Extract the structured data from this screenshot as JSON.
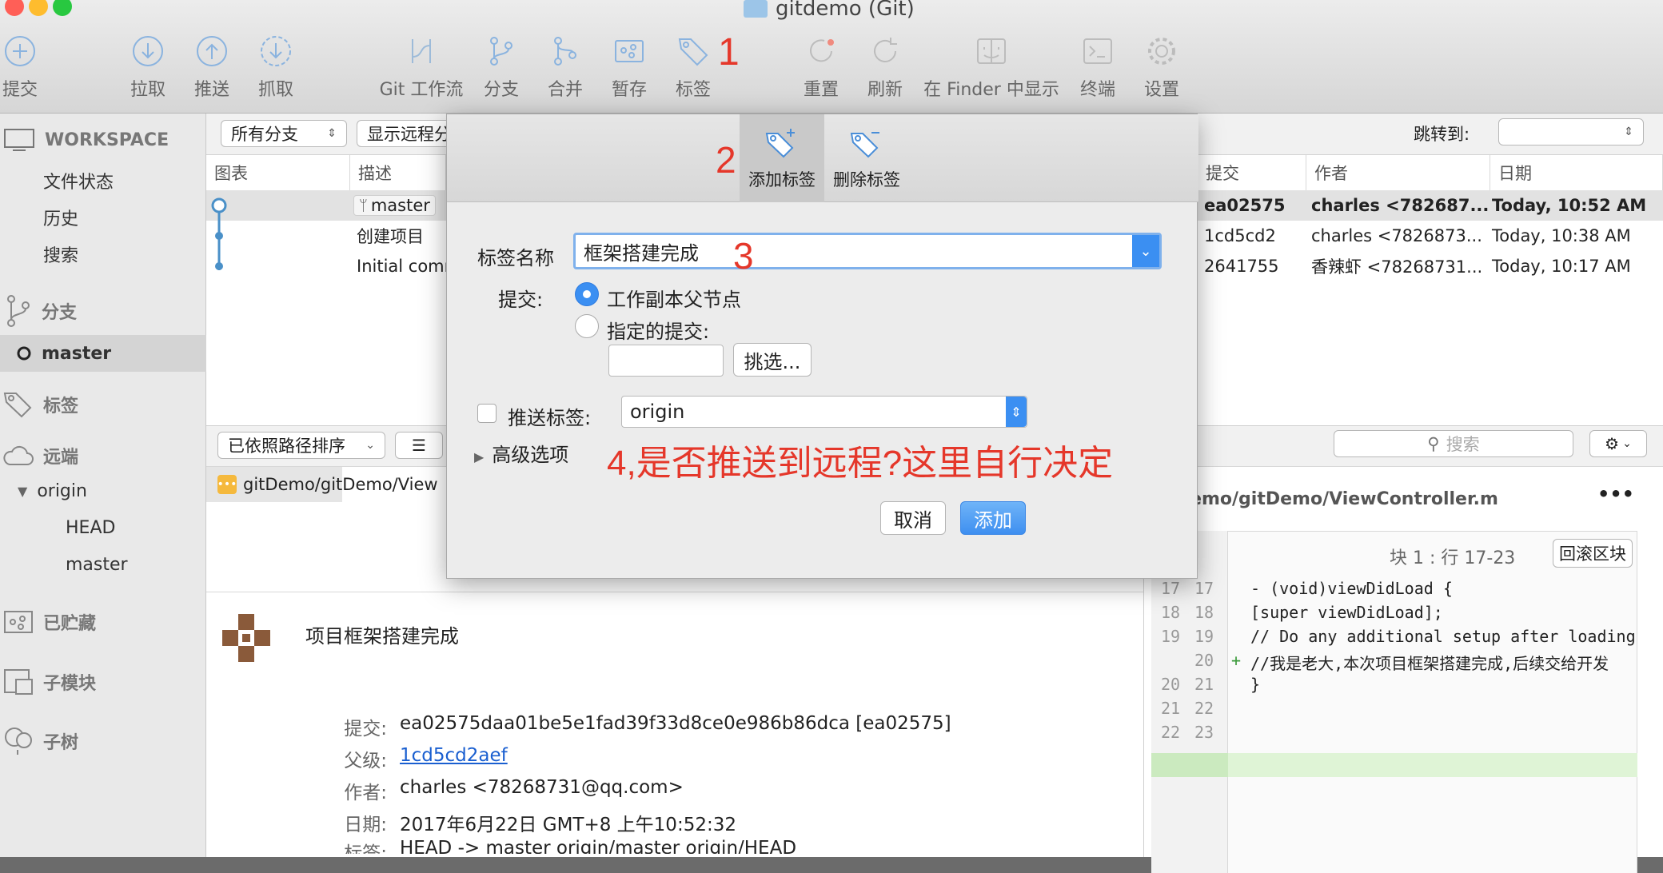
{
  "window": {
    "title": "gitdemo (Git)"
  },
  "toolbar": {
    "commit": "提交",
    "pull": "拉取",
    "push": "推送",
    "fetch": "抓取",
    "gitflow": "Git 工作流",
    "branch": "分支",
    "merge": "合并",
    "stash": "暂存",
    "tag": "标签",
    "reset": "重置",
    "refresh": "刷新",
    "finder": "在 Finder 中显示",
    "terminal": "终端",
    "settings": "设置"
  },
  "annotations": {
    "a1": "1",
    "a2": "2",
    "a3": "3",
    "a4": "4,是否推送到远程?这里自行决定"
  },
  "sidebar": {
    "workspace": "WORKSPACE",
    "file_status": "文件状态",
    "history": "历史",
    "search": "搜索",
    "branches": "分支",
    "master": "master",
    "tags": "标签",
    "remotes": "远端",
    "origin": "origin",
    "head": "HEAD",
    "origin_master": "master",
    "stashes": "已贮藏",
    "submodules": "子模块",
    "subtrees": "子树"
  },
  "filters": {
    "branches": "所有分支",
    "remote": "显示远程分",
    "jump": "跳转到:"
  },
  "log": {
    "columns": {
      "graph": "图表",
      "desc": "描述",
      "commit": "提交",
      "author": "作者",
      "date": "日期"
    },
    "rows": [
      {
        "desc": "master",
        "commit": "ea02575",
        "author": "charles <782687...",
        "date": "Today, 10:52 AM"
      },
      {
        "desc": "创建项目",
        "commit": "1cd5cd2",
        "author": "charles <7826873...",
        "date": "Today, 10:38 AM"
      },
      {
        "desc": "Initial comm",
        "commit": "2641755",
        "author": "香辣虾 <78268731...",
        "date": "Today, 10:17 AM"
      }
    ]
  },
  "files": {
    "sort": "已依照路径排序",
    "path": "gitDemo/gitDemo/View",
    "search_placeholder": "搜索"
  },
  "commit_detail": {
    "message": "项目框架搭建完成",
    "labels": {
      "commit": "提交:",
      "parent": "父级:",
      "author": "作者:",
      "date": "日期:",
      "tags": "标签:"
    },
    "commit": "ea02575daa01be5e1fad39f33d8ce0e986b86dca [ea02575]",
    "parent": "1cd5cd2aef",
    "author": "charles <78268731@qq.com>",
    "date": "2017年6月22日 GMT+8 上午10:52:32",
    "refs": "HEAD -> master origin/master origin/HEAD"
  },
  "diff": {
    "file": "gitDemo/gitDemo/ViewController.m",
    "hunk": "块 1 :  行 17-23",
    "rollback": "回滚区块",
    "lines": [
      {
        "old": "17",
        "new": "17",
        "mark": "",
        "text": "- (void)viewDidLoad {"
      },
      {
        "old": "18",
        "new": "18",
        "mark": "",
        "text": "    [super viewDidLoad];"
      },
      {
        "old": "19",
        "new": "19",
        "mark": "",
        "text": "    // Do any additional setup after loading"
      },
      {
        "old": "",
        "new": "20",
        "mark": "+",
        "text": "    //我是老大,本次项目框架搭建完成,后续交给开发"
      },
      {
        "old": "20",
        "new": "21",
        "mark": "",
        "text": "}"
      },
      {
        "old": "21",
        "new": "22",
        "mark": "",
        "text": ""
      },
      {
        "old": "22",
        "new": "23",
        "mark": "",
        "text": ""
      }
    ]
  },
  "dialog": {
    "tab_add": "添加标签",
    "tab_remove": "删除标签",
    "name_label": "标签名称",
    "name_value": "框架搭建完成",
    "commit_label": "提交:",
    "opt_working": "工作副本父节点",
    "opt_specific": "指定的提交:",
    "pick": "挑选...",
    "push_label": "推送标签:",
    "remote": "origin",
    "advanced": "高级选项",
    "cancel": "取消",
    "add": "添加"
  },
  "colors": {
    "accent": "#3b8ff2",
    "annotation": "#e5372a",
    "added_line_bg": "#dff4d6"
  }
}
